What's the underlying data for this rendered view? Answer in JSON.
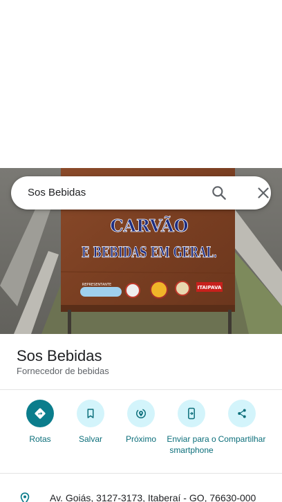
{
  "search": {
    "query": "Sos Bebidas"
  },
  "photo": {
    "sign_line1": "CARVÃO",
    "sign_line2": "E BEBIDAS EM GERAL.",
    "sign_small": "REPRESENTANTE",
    "sign_brand": "ITAIPAVA"
  },
  "place": {
    "title": "Sos Bebidas",
    "category": "Fornecedor de bebidas"
  },
  "actions": [
    {
      "label": "Rotas",
      "icon": "directions-icon"
    },
    {
      "label": "Salvar",
      "icon": "bookmark-icon"
    },
    {
      "label": "Próximo",
      "icon": "nearby-icon"
    },
    {
      "label": "Enviar para o smartphone",
      "icon": "send-to-phone-icon"
    },
    {
      "label": "Compartilhar",
      "icon": "share-icon"
    }
  ],
  "address": {
    "text": "Av. Goiás, 3127-3173, Itaberaí - GO, 76630-000",
    "icon": "location-pin-icon"
  },
  "colors": {
    "accent": "#0b7d8c",
    "accent_light": "#d3f4fb",
    "label_text": "#0b6e7a"
  }
}
